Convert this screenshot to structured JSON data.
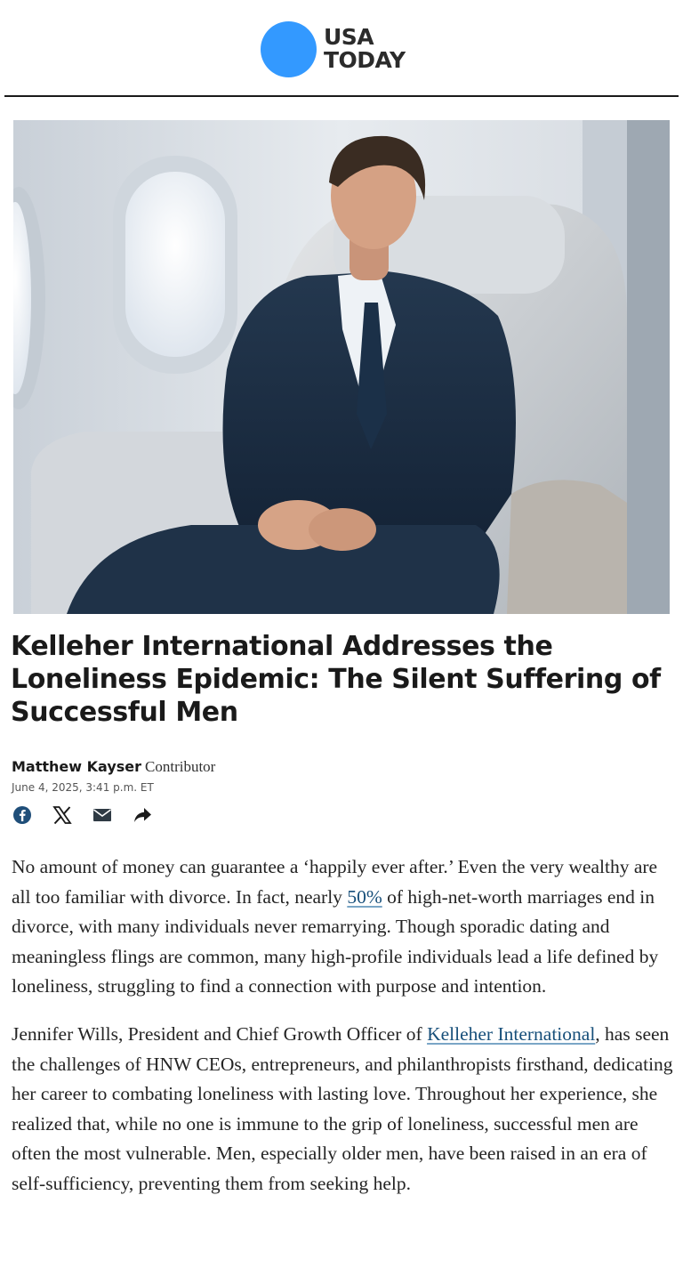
{
  "brand": {
    "logo_line1": "USA",
    "logo_line2": "TODAY",
    "color": "#3399ff"
  },
  "hero": {
    "icon": "photo-man-in-airplane-seat"
  },
  "article": {
    "headline": "Kelleher International Addresses the Loneliness Epidemic: The Silent Suffering of Successful Men",
    "author": "Matthew Kayser",
    "role": "Contributor",
    "date": "June 4, 2025, 3:41 p.m. ET",
    "share": [
      {
        "name": "facebook-icon"
      },
      {
        "name": "x-icon"
      },
      {
        "name": "email-icon"
      },
      {
        "name": "share-icon"
      }
    ],
    "p1": {
      "a": "No amount of money can guarantee a ‘happily ever after.’ Even the very wealthy are all too familiar with divorce. In fact, nearly ",
      "link": "50%",
      "b": " of high-net-worth marriages end in divorce, with many individuals never remarrying. Though sporadic dating and meaningless flings are common, many high-profile individuals lead a life defined by loneliness, struggling to find a connection with purpose and intention."
    },
    "p2": {
      "a": "Jennifer Wills, President and Chief Growth Officer of ",
      "link": "Kelleher International",
      "b": ", has seen the challenges of HNW CEOs, entrepreneurs, and philanthropists firsthand, dedicating her career to combating loneliness with lasting love. Throughout her experience, she realized that, while no one is immune to the grip of loneliness, successful men are often the most vulnerable. Men, especially older men, have been raised in an era of self-sufficiency, preventing them from seeking help."
    },
    "link_color": "#174f7a"
  }
}
